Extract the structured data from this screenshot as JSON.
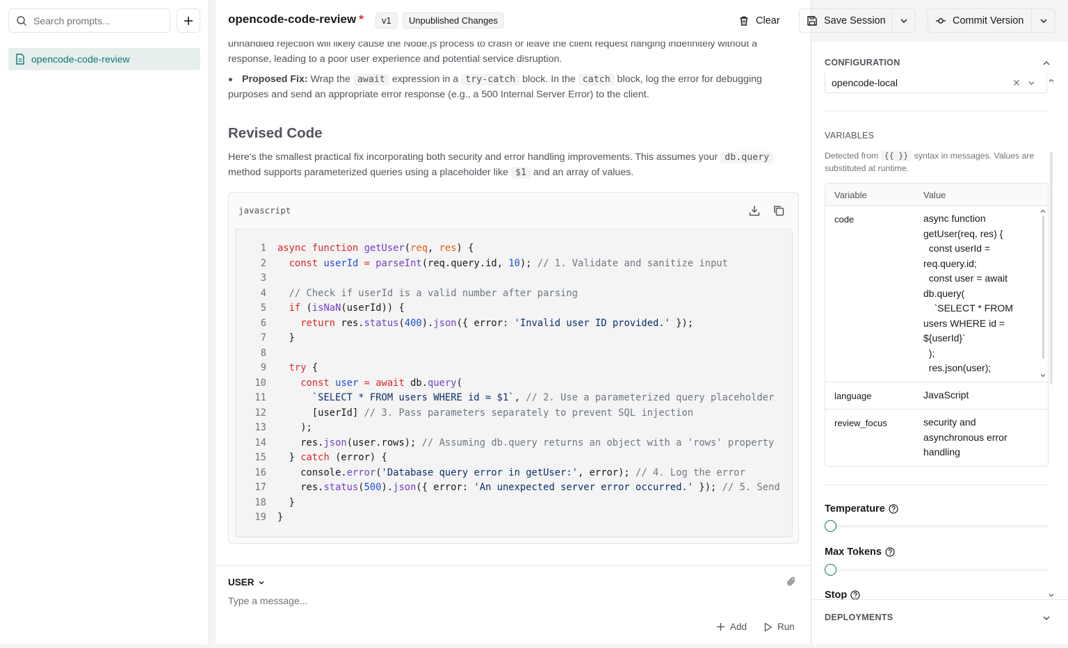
{
  "sidebar": {
    "search_placeholder": "Search prompts...",
    "prompts": [
      {
        "name": "opencode-code-review",
        "active": true
      }
    ]
  },
  "header": {
    "title": "opencode-code-review",
    "unsaved_marker": "*",
    "version": "v1",
    "status": "Unpublished Changes",
    "clear_label": "Clear",
    "save_label": "Save Session",
    "commit_label": "Commit Version"
  },
  "content": {
    "intro_line1": "unhandled rejection will likely cause the Node.js process to crash or leave the client request hanging indefinitely without a",
    "intro_line2": "response, leading to a poor user experience and potential service disruption.",
    "fix_label": "Proposed Fix:",
    "fix_t1": "Wrap the",
    "fix_c1": "await",
    "fix_t2": "expression in a",
    "fix_c2": "try-catch",
    "fix_t3": "block. In the",
    "fix_c3": "catch",
    "fix_t4": "block, log the error for debugging",
    "fix_line2": "purposes and send an appropriate error response (e.g., a 500 Internal Server Error) to the client.",
    "heading": "Revised Code",
    "desc_t1": "Here's the smallest practical fix incorporating both security and error handling improvements. This assumes your",
    "desc_c1": "db.query",
    "desc_t2": "method supports parameterized queries using a placeholder like",
    "desc_c2": "$1",
    "desc_t3": "and an array of values.",
    "code_language": "javascript",
    "code_lines": [
      "async function getUser(req, res) {",
      "  const userId = parseInt(req.query.id, 10); // 1. Validate and sanitize input",
      "",
      "  // Check if userId is a valid number after parsing",
      "  if (isNaN(userId)) {",
      "    return res.status(400).json({ error: 'Invalid user ID provided.' });",
      "  }",
      "",
      "  try {",
      "    const user = await db.query(",
      "      `SELECT * FROM users WHERE id = $1`, // 2. Use a parameterized query placeholder",
      "      [userId] // 3. Pass parameters separately to prevent SQL injection",
      "    );",
      "    res.json(user.rows); // Assuming db.query returns an object with a 'rows' property",
      "  } catch (error) {",
      "    console.error('Database query error in getUser:', error); // 4. Log the error",
      "    res.status(500).json({ error: 'An unexpected server error occurred.' }); // 5. Send",
      "  }",
      "}"
    ]
  },
  "composer": {
    "role": "USER",
    "placeholder": "Type a message...",
    "add_label": "Add",
    "run_label": "Run"
  },
  "panel": {
    "configuration_title": "CONFIGURATION",
    "config_value": "opencode-local",
    "variables_title": "VARIABLES",
    "hint_t1": "Detected from",
    "hint_code": "{{ }}",
    "hint_t2": "syntax in messages. Values are substituted at runtime.",
    "col_variable": "Variable",
    "col_value": "Value",
    "variables": [
      {
        "name": "code",
        "value": "async function getUser(req, res) {\n  const userId = req.query.id;\n  const user = await db.query(\n    `SELECT * FROM users WHERE id = ${userId}`\n  );\n  res.json(user);"
      },
      {
        "name": "language",
        "value": "JavaScript"
      },
      {
        "name": "review_focus",
        "value": "security and asynchronous error handling"
      }
    ],
    "temperature_label": "Temperature",
    "max_tokens_label": "Max Tokens",
    "stop_label": "Stop",
    "deployments_title": "DEPLOYMENTS"
  },
  "colors": {
    "accent": "#0f766e",
    "accent_bg": "#e6efee",
    "danger": "#dc2626"
  }
}
